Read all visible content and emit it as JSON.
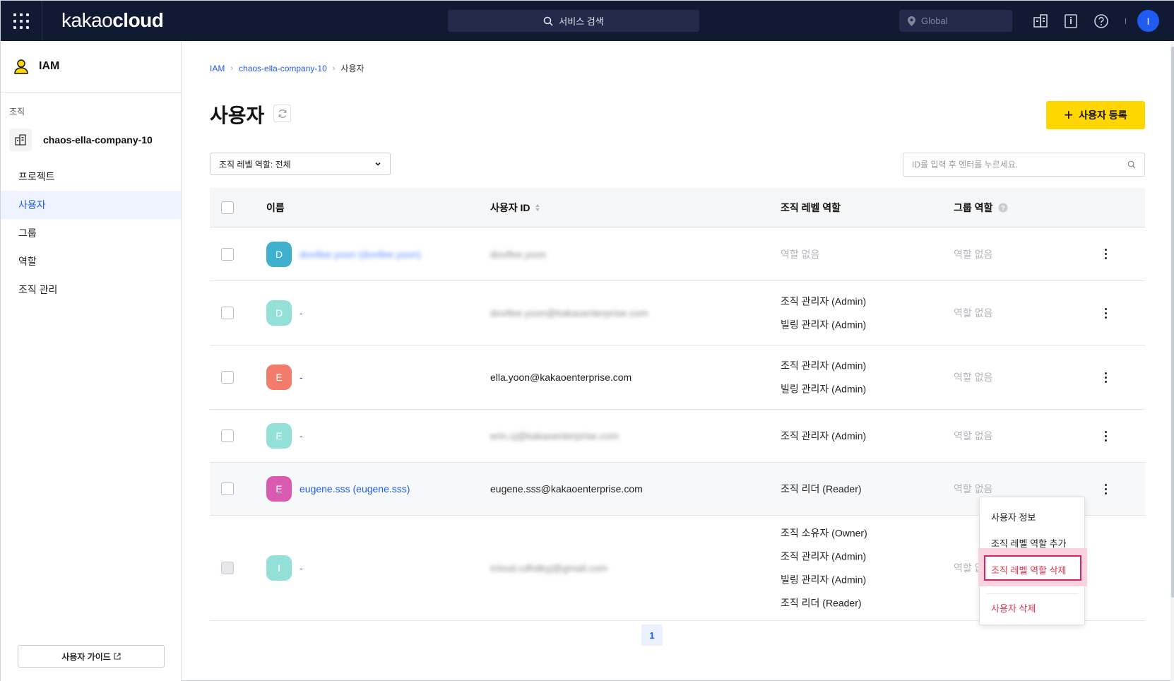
{
  "topbar": {
    "logo_light": "kakao",
    "logo_bold": "cloud",
    "search_label": "서비스 검색",
    "region_label": "Global",
    "user_initial": "I",
    "accent": "#101a33"
  },
  "sidebar": {
    "service_title": "IAM",
    "org_section_label": "조직",
    "org_name": "chaos-ella-company-10",
    "items": [
      {
        "label": "프로젝트"
      },
      {
        "label": "사용자"
      },
      {
        "label": "그룹"
      },
      {
        "label": "역할"
      },
      {
        "label": "조직 관리"
      }
    ],
    "guide_button": "사용자 가이드"
  },
  "breadcrumb": {
    "root": "IAM",
    "org": "chaos-ella-company-10",
    "current": "사용자"
  },
  "page": {
    "title": "사용자",
    "add_button": "사용자 등록",
    "filter_label": "조직 레벨 역할: 전체",
    "search_placeholder": "ID를 입력 후 엔터를 누르세요."
  },
  "table": {
    "headers": {
      "name": "이름",
      "user_id": "사용자 ID",
      "org_role": "조직 레벨 역할",
      "group_role": "그룹 역할"
    },
    "rows": [
      {
        "initial": "D",
        "avatar_color": "#3fb1cf",
        "name": "dovifee.yoon (dovifee.yoon)",
        "user_id": "dovifee.yoon",
        "roles": [
          "역할 없음"
        ],
        "roles_muted": true,
        "group_role": "역할 없음"
      },
      {
        "initial": "D",
        "avatar_color": "#93e0d9",
        "name": "-",
        "user_id": "dovifee.yoon@kakaoenterprise.com",
        "roles": [
          "조직 관리자 (Admin)",
          "빌링 관리자 (Admin)"
        ],
        "roles_muted": false,
        "group_role": "역할 없음"
      },
      {
        "initial": "E",
        "avatar_color": "#f27b6b",
        "name": "-",
        "user_id": "ella.yoon@kakaoenterprise.com",
        "roles": [
          "조직 관리자 (Admin)",
          "빌링 관리자 (Admin)"
        ],
        "roles_muted": false,
        "group_role": "역할 없음"
      },
      {
        "initial": "E",
        "avatar_color": "#93e0d9",
        "name": "-",
        "user_id": "erin.cj@kakaoenterprise.com",
        "roles": [
          "조직 관리자 (Admin)"
        ],
        "roles_muted": false,
        "group_role": "역할 없음"
      },
      {
        "initial": "E",
        "avatar_color": "#d85bb0",
        "name": "eugene.sss (eugene.sss)",
        "user_id": "eugene.sss@kakaoenterprise.com",
        "roles": [
          "조직 리더 (Reader)"
        ],
        "roles_muted": false,
        "group_role": "역할 없음"
      },
      {
        "initial": "I",
        "avatar_color": "#93e0d9",
        "name": "-",
        "user_id": "icloud.cdhdkyj@gmail.com",
        "roles": [
          "조직 소유자 (Owner)",
          "조직 관리자 (Admin)",
          "빌링 관리자 (Admin)",
          "조직 리더 (Reader)"
        ],
        "roles_muted": false,
        "group_role": "역할 없음"
      }
    ]
  },
  "context_menu": {
    "items": [
      {
        "label": "사용자 정보"
      },
      {
        "label": "조직 레벨 역할 추가"
      },
      {
        "label": "조직 레벨 역할 삭제"
      },
      {
        "label": "사용자 삭제"
      }
    ],
    "danger_color": "#e0344f"
  },
  "pagination": {
    "current": "1"
  }
}
